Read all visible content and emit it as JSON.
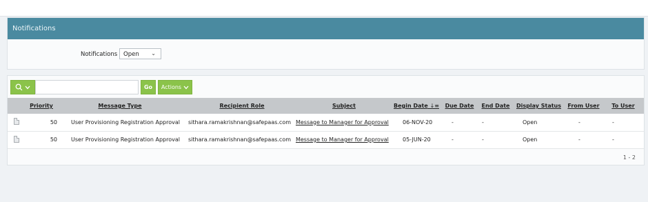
{
  "region": {
    "title": "Notifications"
  },
  "filter": {
    "label": "Notifications",
    "value": "Open"
  },
  "toolbar": {
    "go_label": "Go",
    "actions_label": "Actions"
  },
  "table": {
    "columns": [
      "Priority",
      "Message Type",
      "Recipient Role",
      "Subject",
      "Begin Date",
      "Due Date",
      "End Date",
      "Display Status",
      "From User",
      "To User"
    ],
    "sort_indicator": "↓≡",
    "rows": [
      {
        "priority": "50",
        "message_type": "User Provisioning Registration Approval",
        "recipient_role": "sithara.ramakrishnan@safepaas.com",
        "subject": "Message to Manager for Approval",
        "begin_date": "06-NOV-20",
        "due_date": "-",
        "end_date": "-",
        "display_status": "Open",
        "from_user": "-",
        "to_user": "-"
      },
      {
        "priority": "50",
        "message_type": "User Provisioning Registration Approval",
        "recipient_role": "sithara.ramakrishnan@safepaas.com",
        "subject": "Message to Manager for Approval",
        "begin_date": "05-JUN-20",
        "due_date": "-",
        "end_date": "-",
        "display_status": "Open",
        "from_user": "-",
        "to_user": "-"
      }
    ]
  },
  "pagination": {
    "text": "1 - 2"
  }
}
